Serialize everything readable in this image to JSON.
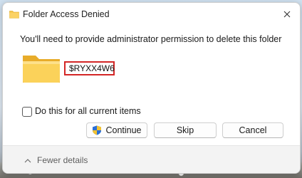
{
  "window": {
    "title": "Folder Access Denied",
    "close_icon": "close-icon",
    "title_icon": "folder-icon"
  },
  "main": {
    "message": "You'll need to provide administrator permission to delete this folder",
    "folder_name": "$RYXX4W6",
    "folder_icon": "folder-icon"
  },
  "options": {
    "checkbox_label": "Do this for all current items",
    "checkbox_checked": false
  },
  "buttons": {
    "continue_label": "Continue",
    "skip_label": "Skip",
    "cancel_label": "Cancel",
    "continue_icon": "uac-shield-icon"
  },
  "footer": {
    "fewer_details_label": "Fewer details",
    "chevron_icon": "chevron-up-icon"
  },
  "colors": {
    "highlight_border": "#d32626",
    "folder_yellow": "#f6c343",
    "footer_bg": "#f3f3f3"
  }
}
